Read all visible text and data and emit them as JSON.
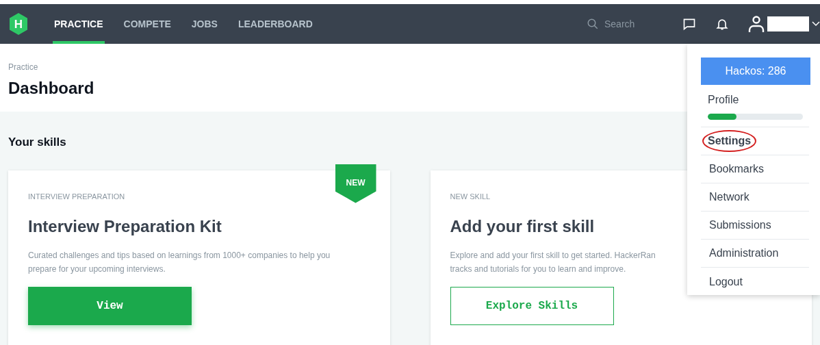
{
  "nav": {
    "logo": "H",
    "tabs": [
      {
        "label": "PRACTICE",
        "selected": true
      },
      {
        "label": "COMPETE",
        "selected": false
      },
      {
        "label": "JOBS",
        "selected": false
      },
      {
        "label": "LEADERBOARD",
        "selected": false
      }
    ],
    "search": {
      "placeholder": "Search"
    }
  },
  "breadcrumb": "Practice",
  "page_title": "Dashboard",
  "section_title": "Your skills",
  "cards": [
    {
      "eyebrow": "INTERVIEW PREPARATION",
      "title": "Interview Preparation Kit",
      "badge": "NEW",
      "description_lines": [
        "Curated challenges and tips based on learnings from 1000+ companies to help you",
        "prepare for your upcoming interviews."
      ],
      "button": {
        "label": "View",
        "kind": "filled"
      }
    },
    {
      "eyebrow": "NEW SKILL",
      "title": "Add your first skill",
      "description_lines": [
        "Explore and add your first skill to get started. HackerRan",
        "tracks and tutorials for you to learn and improve."
      ],
      "button": {
        "label": "Explore Skills",
        "kind": "outline"
      }
    }
  ],
  "menu": {
    "hackos": "Hackos: 286",
    "profile": {
      "label": "Profile",
      "level": 0.3
    },
    "items": [
      {
        "label": "Settings",
        "selected": true
      },
      {
        "label": "Bookmarks",
        "selected": false
      },
      {
        "label": "Network",
        "selected": false
      },
      {
        "label": "Submissions",
        "selected": false
      },
      {
        "label": "Administration",
        "selected": false
      },
      {
        "label": "Logout",
        "selected": false
      }
    ]
  }
}
